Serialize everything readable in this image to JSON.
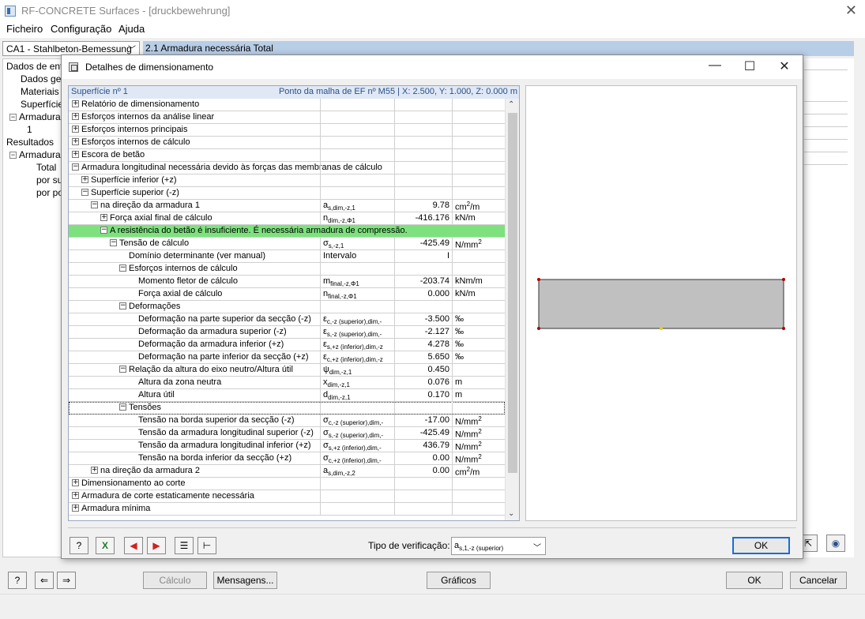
{
  "window": {
    "title": "RF-CONCRETE Surfaces - [druckbewehrung]",
    "close_glyph": "✕"
  },
  "menu": [
    "Ficheiro",
    "Configuração",
    "Ajuda"
  ],
  "case_combo": "CA1 - Stahlbeton-Bemessung",
  "result_header": "2.1 Armadura necessária Total",
  "navtree": [
    {
      "label": "Dados de entr",
      "expander": ""
    },
    {
      "label": "Dados ger",
      "expander": ""
    },
    {
      "label": "Materiais",
      "expander": ""
    },
    {
      "label": "Superfícies",
      "expander": ""
    },
    {
      "label": "Armadura",
      "expander": "−"
    },
    {
      "label": "1",
      "expander": ""
    },
    {
      "label": "Resultados",
      "expander": ""
    },
    {
      "label": "Armadura",
      "expander": "−"
    },
    {
      "label": "Total",
      "expander": ""
    },
    {
      "label": "por su",
      "expander": ""
    },
    {
      "label": "por po",
      "expander": ""
    }
  ],
  "bottom": {
    "calc": "Cálculo",
    "messages": "Mensagens...",
    "graphics": "Gráficos",
    "ok": "OK",
    "cancel": "Cancelar"
  },
  "dialog": {
    "title": "Detalhes de dimensionamento",
    "minimize": "—",
    "maximize": "☐",
    "close": "✕",
    "surface": "Superfície nº 1",
    "location": "Ponto da malha de EF nº M55  |  X: 2.500, Y: 1.000, Z: 0.000 m",
    "verification_label": "Tipo de verificação:",
    "verification_value": {
      "main": "a",
      "sub": "s,1,-z (superior)"
    },
    "ok": "OK"
  },
  "rows": [
    {
      "label": "Relatório de dimensionamento",
      "pm": "+",
      "level": 0
    },
    {
      "label": "Esforços internos da análise linear",
      "pm": "+",
      "level": 0
    },
    {
      "label": "Esforços internos principais",
      "pm": "+",
      "level": 0
    },
    {
      "label": "Esforços internos de cálculo",
      "pm": "+",
      "level": 0
    },
    {
      "label": "Escora de betão",
      "pm": "+",
      "level": 0
    },
    {
      "label": "Armadura longitudinal necessária devido às forças das membranas de cálculo",
      "pm": "−",
      "level": 0
    },
    {
      "label": "Superfície inferior (+z)",
      "pm": "+",
      "level": 1
    },
    {
      "label": "Superfície superior (-z)",
      "pm": "−",
      "level": 1
    },
    {
      "label": "na direção da armadura 1",
      "pm": "−",
      "level": 2,
      "sym": "a",
      "sub": "s,dim,-z,1",
      "val": "9.78",
      "unit": "cm",
      "sup": "2",
      "unit2": "/m"
    },
    {
      "label": "Força axial final de cálculo",
      "pm": "+",
      "level": 3,
      "sym": "n",
      "sub": "dim,-z,Φ1",
      "val": "-416.176",
      "unit": "kN/m"
    },
    {
      "label": "A resistência do betão é insuficiente. É necessária armadura de compressão.",
      "pm": "−",
      "level": 3,
      "highlight": true
    },
    {
      "label": "Tensão de cálculo",
      "pm": "−",
      "level": 4,
      "sym": "σ",
      "sub": "s,-z,1",
      "val": "-425.49",
      "unit": "N/mm",
      "sup": "2"
    },
    {
      "label": "Domínio determinante (ver manual)",
      "pm": "",
      "level": 6,
      "sym": "Intervalo",
      "val": "I"
    },
    {
      "label": "Esforços internos de cálculo",
      "pm": "−",
      "level": 5
    },
    {
      "label": "Momento fletor de cálculo",
      "pm": "",
      "level": 7,
      "sym": "m",
      "sub": "final,-z,Φ1",
      "val": "-203.74",
      "unit": "kNm/m"
    },
    {
      "label": "Força axial de cálculo",
      "pm": "",
      "level": 7,
      "sym": "n",
      "sub": "final,-z,Φ1",
      "val": "0.000",
      "unit": "kN/m"
    },
    {
      "label": "Deformações",
      "pm": "−",
      "level": 5
    },
    {
      "label": "Deformação na parte superior da secção (-z)",
      "pm": "",
      "level": 7,
      "sym": "ε",
      "sub": "c,-z (superior),dim,-",
      "val": "-3.500",
      "unit": "‰"
    },
    {
      "label": "Deformação da armadura superior (-z)",
      "pm": "",
      "level": 7,
      "sym": "ε",
      "sub": "s,-z (superior),dim,-",
      "val": "-2.127",
      "unit": "‰"
    },
    {
      "label": "Deformação da armadura inferior (+z)",
      "pm": "",
      "level": 7,
      "sym": "ε",
      "sub": "s,+z (inferior),dim,-z",
      "val": "4.278",
      "unit": "‰"
    },
    {
      "label": "Deformação na parte inferior da secção (+z)",
      "pm": "",
      "level": 7,
      "sym": "ε",
      "sub": "c,+z (inferior),dim,-z",
      "val": "5.650",
      "unit": "‰"
    },
    {
      "label": "Relação da altura do eixo neutro/Altura útil",
      "pm": "−",
      "level": 5,
      "sym": "ψ",
      "sub": "dim,-z,1",
      "val": "0.450"
    },
    {
      "label": "Altura da zona neutra",
      "pm": "",
      "level": 7,
      "sym": "x",
      "sub": "dim,-z,1",
      "val": "0.076",
      "unit": "m"
    },
    {
      "label": "Altura útil",
      "pm": "",
      "level": 7,
      "sym": "d",
      "sub": "dim,-z,1",
      "val": "0.170",
      "unit": "m"
    },
    {
      "label": "Tensões",
      "pm": "−",
      "level": 5,
      "focus": true
    },
    {
      "label": "Tensão na borda superior da secção (-z)",
      "pm": "",
      "level": 7,
      "sym": "σ",
      "sub": "c,-z (superior),dim,-",
      "val": "-17.00",
      "unit": "N/mm",
      "sup": "2"
    },
    {
      "label": "Tensão da armadura longitudinal superior (-z)",
      "pm": "",
      "level": 7,
      "sym": "σ",
      "sub": "s,-z (superior),dim,-",
      "val": "-425.49",
      "unit": "N/mm",
      "sup": "2"
    },
    {
      "label": "Tensão da armadura longitudinal inferior (+z)",
      "pm": "",
      "level": 7,
      "sym": "σ",
      "sub": "s,+z (inferior),dim,-",
      "val": "436.79",
      "unit": "N/mm",
      "sup": "2"
    },
    {
      "label": "Tensão na borda inferior da secção (+z)",
      "pm": "",
      "level": 7,
      "sym": "σ",
      "sub": "c,+z (inferior),dim,-",
      "val": "0.00",
      "unit": "N/mm",
      "sup": "2"
    },
    {
      "label": "na direção da armadura 2",
      "pm": "+",
      "level": 2,
      "sym": "a",
      "sub": "s,dim,-z,2",
      "val": "0.00",
      "unit": "cm",
      "sup": "2",
      "unit2": "/m"
    },
    {
      "label": "Dimensionamento ao corte",
      "pm": "+",
      "level": 0
    },
    {
      "label": "Armadura de corte estaticamente necessária",
      "pm": "+",
      "level": 0
    },
    {
      "label": "Armadura mínima",
      "pm": "+",
      "level": 0
    }
  ],
  "icons": {
    "help": "help-icon",
    "excel": "excel-icon",
    "prev": "arrow-left-icon",
    "next": "arrow-right-icon",
    "list": "list-icon",
    "tree": "tree-icon"
  },
  "colors": {
    "highlight_row": "#7de27d",
    "section_fill": "#c0c0c0",
    "result_header": "#b8cde6"
  }
}
